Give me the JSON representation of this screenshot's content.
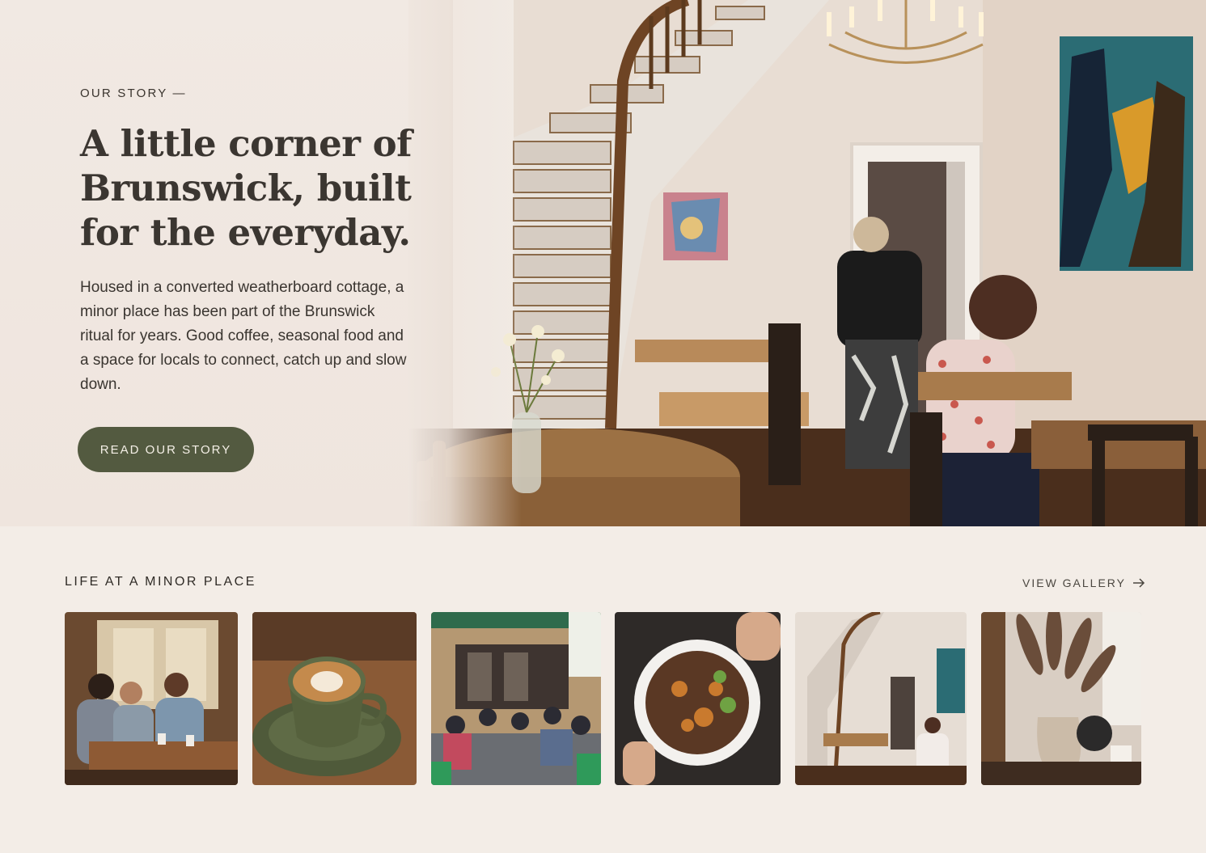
{
  "hero": {
    "eyebrow": "OUR STORY —",
    "headline": "A little corner of Brunswick, built for the everyday.",
    "intro": "Housed in a converted weatherboard cottage, a minor place has been part of the Brunswick ritual for years. Good coffee, seasonal food and a space for locals to connect, catch up and slow down.",
    "cta_label": "READ OUR STORY"
  },
  "gallery": {
    "title": "LIFE AT A MINOR PLACE",
    "link_label": "VIEW GALLERY",
    "link_icon": "arrow-right-icon"
  },
  "colors": {
    "background": "#f3ede7",
    "cta": "#535a40",
    "text": "#2f2b26"
  }
}
